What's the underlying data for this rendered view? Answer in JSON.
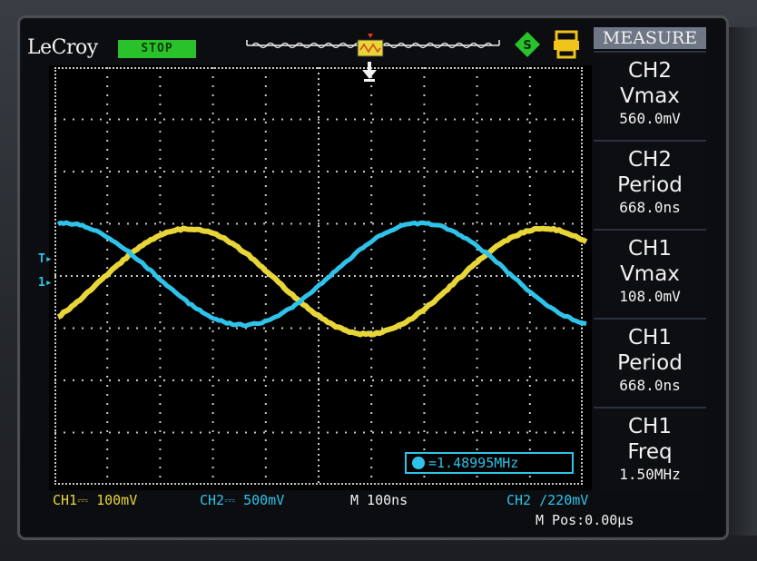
{
  "brand": "LeCroy",
  "acquisition_status": "STOP",
  "measure_menu": {
    "title": "MEASURE",
    "items": [
      {
        "channel": "CH2",
        "parameter": "Vmax",
        "value": "560.0mV"
      },
      {
        "channel": "CH2",
        "parameter": "Period",
        "value": "668.0ns"
      },
      {
        "channel": "CH1",
        "parameter": "Vmax",
        "value": "108.0mV"
      },
      {
        "channel": "CH1",
        "parameter": "Period",
        "value": "668.0ns"
      },
      {
        "channel": "CH1",
        "parameter": "Freq",
        "value": "1.50MHz"
      }
    ]
  },
  "frequency_counter": "=1.48995MHz",
  "status_bar": {
    "ch1_scale": "CH1⎓ 100mV",
    "ch2_scale": "CH2⎓ 500mV",
    "timebase": "M 100ns",
    "trigger": "CH2 ∕220mV",
    "position": "M Pos:0.00μs"
  },
  "markers": {
    "trigger_level": "T",
    "ch1_ground": "1"
  },
  "colors": {
    "ch1": "#e8d538",
    "ch2": "#2ec3ea",
    "grid": "#c9c9c9",
    "status_green": "#29c22a"
  }
}
